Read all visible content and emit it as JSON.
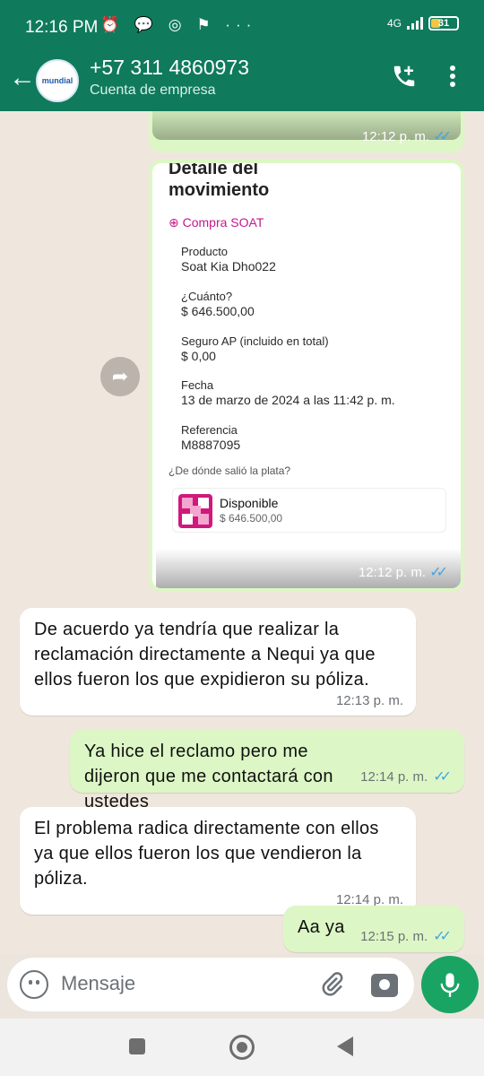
{
  "status": {
    "time": "12:16 PM",
    "battery": "31",
    "net": "4G",
    "icons_text": "⏰ 💬 ◎ ⚑ ···"
  },
  "header": {
    "title": "+57 311 4860973",
    "subtitle": "Cuenta de empresa",
    "avatar_text": "mundial"
  },
  "messages": {
    "img_top_time": "12:12 p. m.",
    "img_time": "12:12 p. m.",
    "m1_text": "De acuerdo ya tendría que realizar la reclamación directamente a Nequi ya que ellos fueron los que expidieron su póliza.",
    "m1_time": "12:13 p. m.",
    "m2_text": "Ya hice el reclamo pero me dijeron que me contactará con ustedes",
    "m2_time": "12:14 p. m.",
    "m3_text": "El problema radica directamente con ellos ya que ellos fueron los que vendieron la póliza.",
    "m3_time": "12:14 p. m.",
    "m4_text": "Aa ya",
    "m4_time": "12:15 p. m."
  },
  "receipt": {
    "title": "Detalle del movimiento",
    "tag": "Compra SOAT",
    "producto_label": "Producto",
    "producto_value": "Soat Kia Dho022",
    "cuanto_label": "¿Cuánto?",
    "cuanto_value": "$ 646.500,00",
    "seguro_label": "Seguro AP (incluido en total)",
    "seguro_value": "$ 0,00",
    "fecha_label": "Fecha",
    "fecha_value": "13 de marzo de 2024 a las 11:42 p. m.",
    "ref_label": "Referencia",
    "ref_value": "M8887095",
    "question": "¿De dónde salió la plata?",
    "pay_title": "Disponible",
    "pay_amount": "$ 646.500,00"
  },
  "input": {
    "placeholder": "Mensaje"
  },
  "colors": {
    "header": "#0f7a5c",
    "outgoing": "#dcf7c5",
    "incoming": "#ffffff",
    "mic": "#19a463",
    "tag": "#c2198d"
  }
}
